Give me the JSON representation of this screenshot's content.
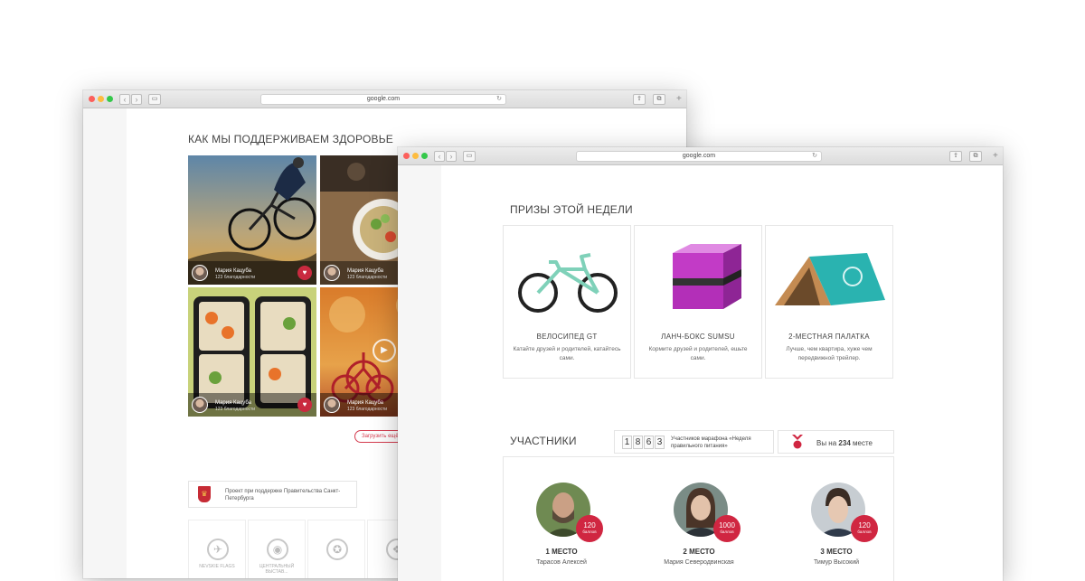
{
  "window_back": {
    "url": "google.com",
    "heading": "КАК МЫ ПОДДЕРЖИВАЕМ ЗДОРОВЬЕ",
    "tiles": [
      {
        "author": "Мария Кацуба",
        "likes": "123 благодарности"
      },
      {
        "author": "Мария Кацуба",
        "likes": "123 благодарности"
      },
      {
        "author": "Мария Кацуба",
        "likes": "123 благодарности"
      },
      {
        "author": "Мария Кацуба",
        "likes": "123 благодарности"
      }
    ],
    "load_more_label": "Загрузить ещё",
    "gov_text": "Проект при поддержке Правительства Санкт-Петербурга",
    "partners": [
      "NEVSKIE FLAGS",
      "ЦЕНТРАЛЬНЫЙ ВЫСТАВ...",
      "",
      ""
    ]
  },
  "window_front": {
    "url": "google.com",
    "prizes_heading": "ПРИЗЫ ЭТОЙ НЕДЕЛИ",
    "prizes": [
      {
        "title": "ВЕЛОСИПЕД GT",
        "desc": "Катайте друзей и родителей, катайтесь сами."
      },
      {
        "title": "ЛАНЧ-БОКС SUMSU",
        "desc": "Кормите друзей и родителей, ешьте сами."
      },
      {
        "title": "2-МЕСТНАЯ ПАЛАТКА",
        "desc": "Лучше, чем квартира, хуже чем передвижной трейлер."
      }
    ],
    "participants_heading": "УЧАСТНИКИ",
    "counter": {
      "digits": [
        "1",
        "8",
        "6",
        "3"
      ],
      "text": "Участников марафона «Неделя правильного питания»"
    },
    "rank": {
      "prefix": "Вы на",
      "value": "234",
      "suffix": "месте"
    },
    "people": [
      {
        "place": "1 МЕСТО",
        "name": "Тарасов Алексей",
        "points": "120",
        "unit": "баллов"
      },
      {
        "place": "2 МЕСТО",
        "name": "Мария Северодвинская",
        "points": "1000",
        "unit": "баллов"
      },
      {
        "place": "3 МЕСТО",
        "name": "Тимур Высокий",
        "points": "120",
        "unit": "баллов"
      }
    ]
  },
  "colors": {
    "accent": "#d02641"
  }
}
